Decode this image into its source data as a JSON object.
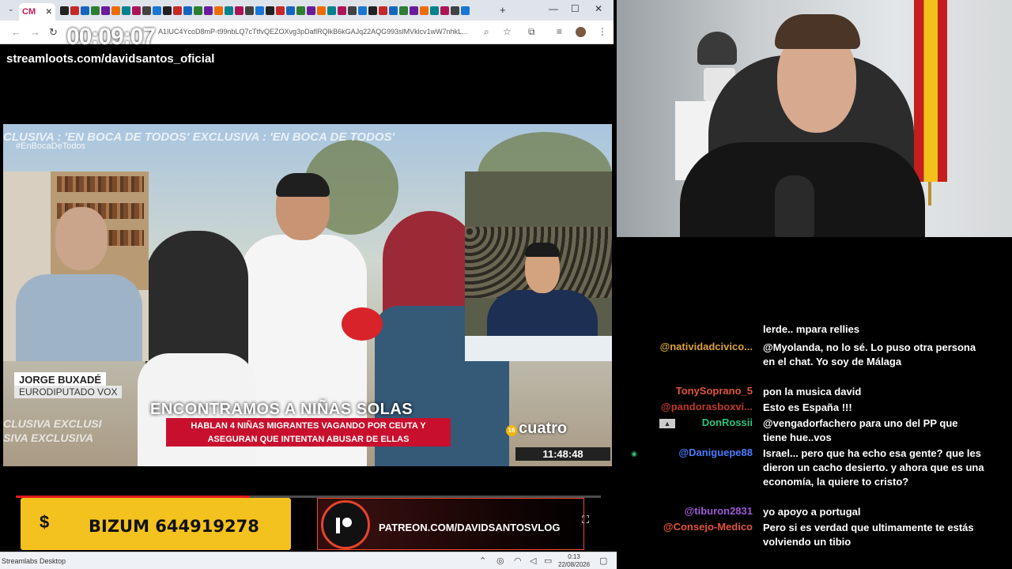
{
  "browser": {
    "active_tab_label": "CM",
    "address_url": "A1IUC4YcoD8mP-t99nbLQ7cTtfvQEZOXvg3pDaflRQlkB6kGAJq22AQG993slMVklcv1wW7nhkL...",
    "new_tab": "+",
    "controls": {
      "minimize": "—",
      "maximize": "☐",
      "close": "✕"
    }
  },
  "stream_overlay": {
    "timer": "00:09:07",
    "streamloots": "streamloots.com/davidsantos_oficial"
  },
  "video": {
    "ticker": "CLUSIVA : 'EN BOCA DE TODOS'          EXCLUSIVA : 'EN BOCA DE TODOS'",
    "hashtag": "#EnBocaDeTodos",
    "guest_name": "JORGE BUXADÉ",
    "guest_role": "EURODIPUTADO VOX",
    "headline": "ENCONTRAMOS A NIÑAS SOLAS",
    "subheadline_1": "HABLAN 4 NIÑAS MIGRANTES VAGANDO POR CEUTA Y",
    "subheadline_2": "ASEGURAN QUE INTENTAN ABUSAR DE ELLAS",
    "exclusive_strip_1": "CLUSIVA   EXCLUSI",
    "exclusive_strip_2": "SIVA   EXCLUSIVA",
    "channel_rating": "16",
    "channel_name": "cuatro",
    "clock": "11:48:48",
    "progress_percent": 40
  },
  "overlays": {
    "bizum_symbol": "$",
    "bizum_text": "BIZUM 644919278",
    "patreon_text": "PATREON.COM/DAVIDSANTOSVLOG"
  },
  "taskbar": {
    "title": "Streamlabs Desktop",
    "time": "0:13",
    "date": "22/08/2026"
  },
  "chat": [
    {
      "user": "",
      "text": "lerde.. mpara rellies",
      "user_color": "#ffffff"
    },
    {
      "user": "@natividadcivico...",
      "text": "@Myolanda, no lo sé. Lo puso otra persona en el chat. Yo soy de Málaga",
      "user_color": "#d9a23a"
    },
    {
      "user": "TonySoprano_5",
      "text": "pon la musica david",
      "user_color": "#e2543a"
    },
    {
      "user": "@pandorasboxvi...",
      "text": "Esto es España !!!",
      "user_color": "#c0392b"
    },
    {
      "user": "DonRossii",
      "text": "@vengadorfachero para uno del PP que tiene hue..vos",
      "user_color": "#2ec27e",
      "badge": "▲"
    },
    {
      "user": "@Daniguepe88",
      "text": "Israel... pero que ha echo esa gente? que les dieron un cacho desierto. y ahora que es una economía, la quiere to cristo?",
      "user_color": "#4a7dff",
      "badge": "◉"
    },
    {
      "user": "@tiburon2831",
      "text": "yo apoyo a portugal",
      "user_color": "#9b59d6"
    },
    {
      "user": "@Consejo-Medico",
      "text": "Pero si es verdad que ultimamente te estás volviendo un tibio",
      "user_color": "#e2543a"
    }
  ],
  "colors": {
    "bizum_yellow": "#f4c21e",
    "patreon_red": "#e8432b",
    "headline_red": "#c8102e",
    "progress_red": "#e21b1b"
  }
}
